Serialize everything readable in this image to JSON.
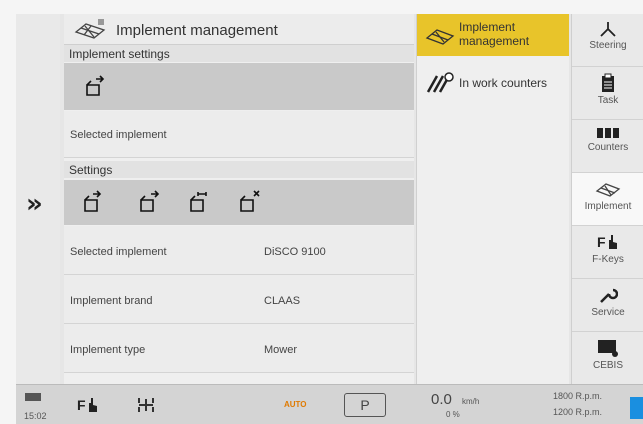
{
  "main": {
    "title": "Implement management",
    "section1": "Implement settings",
    "row1_label": "Selected implement",
    "section2": "Settings",
    "rows": [
      {
        "label": "Selected implement",
        "value": "DiSCO 9100"
      },
      {
        "label": "Implement brand",
        "value": "CLAAS"
      },
      {
        "label": "Implement type",
        "value": "Mower"
      }
    ]
  },
  "menu": {
    "items": [
      {
        "label_line1": "Implement",
        "label_line2": "management",
        "active": true
      },
      {
        "label_line1": "In work counters",
        "label_line2": "",
        "active": false
      }
    ]
  },
  "nav": {
    "items": [
      {
        "label": "Steering",
        "icon": "steering-icon"
      },
      {
        "label": "Task",
        "icon": "clipboard-icon"
      },
      {
        "label": "Counters",
        "icon": "counters-icon"
      },
      {
        "label": "Implement",
        "icon": "implement-icon",
        "active": true
      },
      {
        "label": "F-Keys",
        "icon": "fkeys-icon"
      },
      {
        "label": "Service",
        "icon": "wrench-icon"
      },
      {
        "label": "CEBIS",
        "icon": "cebis-icon"
      }
    ]
  },
  "status": {
    "time": "15:02",
    "auto": "AUTO",
    "gear": "P",
    "speed": "0.0",
    "speed_unit": "km/h",
    "slip": "0 %",
    "rpm1": "1800 R.p.m.",
    "rpm2": "1200 R.p.m."
  },
  "colors": {
    "accent": "#e8c42a",
    "toolbar": "#c9c9c9"
  }
}
